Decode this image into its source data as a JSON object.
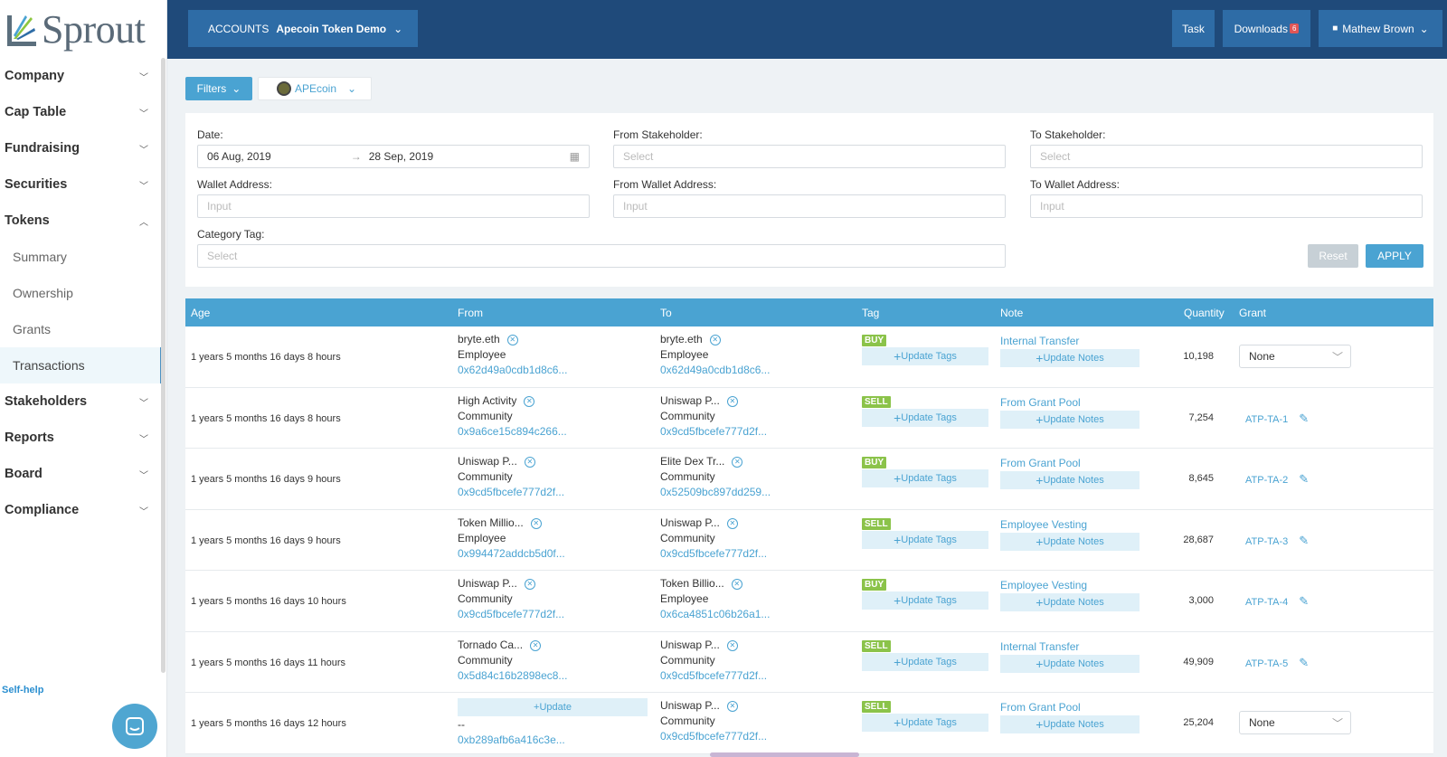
{
  "logo": {
    "text": "Sprout"
  },
  "sidebar": {
    "items": [
      {
        "label": "Company",
        "expanded": false
      },
      {
        "label": "Cap Table",
        "expanded": false
      },
      {
        "label": "Fundraising",
        "expanded": false
      },
      {
        "label": "Securities",
        "expanded": false
      },
      {
        "label": "Tokens",
        "expanded": true
      },
      {
        "label": "Stakeholders",
        "expanded": false
      },
      {
        "label": "Reports",
        "expanded": false
      },
      {
        "label": "Board",
        "expanded": false
      },
      {
        "label": "Compliance",
        "expanded": false
      }
    ],
    "token_subitems": [
      "Summary",
      "Ownership",
      "Grants",
      "Transactions"
    ],
    "active_subitem": "Transactions",
    "self_help": "Self-help"
  },
  "header": {
    "accounts_label": "ACCOUNTS",
    "account_name": "Apecoin Token Demo",
    "task": "Task",
    "downloads": "Downloads",
    "downloads_count": "6",
    "user": "Mathew Brown"
  },
  "filterbar": {
    "filters": "Filters",
    "token": "APEcoin"
  },
  "panel": {
    "date_label": "Date",
    "date_from": "06 Aug, 2019",
    "date_to": "28 Sep, 2019",
    "from_stakeholder_label": "From Stakeholder",
    "to_stakeholder_label": "To Stakeholder",
    "wallet_label": "Wallet Address",
    "from_wallet_label": "From Wallet Address",
    "to_wallet_label": "To Wallet Address",
    "category_label": "Category Tag",
    "select_ph": "Select",
    "input_ph": "Input",
    "reset": "Reset",
    "apply": "APPLY"
  },
  "table": {
    "columns": [
      "Age",
      "From",
      "To",
      "Tag",
      "Note",
      "Quantity",
      "Grant"
    ],
    "update_tags": "Update Tags",
    "update_notes": "Update Notes",
    "update": "Update",
    "rows": [
      {
        "age": "1 years 5 months 16 days 8 hours",
        "from_name": "bryte.eth",
        "from_role": "Employee",
        "from_addr": "0x62d49a0cdb1d8c6...",
        "to_name": "bryte.eth",
        "to_role": "Employee",
        "to_addr": "0x62d49a0cdb1d8c6...",
        "tag": "BUY",
        "note": "Internal Transfer",
        "qty": "10,198",
        "grant": "None",
        "grant_type": "select"
      },
      {
        "age": "1 years 5 months 16 days 8 hours",
        "from_name": "High Activity",
        "from_role": "Community",
        "from_addr": "0x9a6ce15c894c266...",
        "to_name": "Uniswap P...",
        "to_role": "Community",
        "to_addr": "0x9cd5fbcefe777d2f...",
        "tag": "SELL",
        "note": "From Grant Pool",
        "qty": "7,254",
        "grant": "ATP-TA-1",
        "grant_type": "link"
      },
      {
        "age": "1 years 5 months 16 days 9 hours",
        "from_name": "Uniswap P...",
        "from_role": "Community",
        "from_addr": "0x9cd5fbcefe777d2f...",
        "to_name": "Elite Dex Tr...",
        "to_role": "Community",
        "to_addr": "0x52509bc897dd259...",
        "tag": "BUY",
        "note": "From Grant Pool",
        "qty": "8,645",
        "grant": "ATP-TA-2",
        "grant_type": "link"
      },
      {
        "age": "1 years 5 months 16 days 9 hours",
        "from_name": "Token Millio...",
        "from_role": "Employee",
        "from_addr": "0x994472addcb5d0f...",
        "to_name": "Uniswap P...",
        "to_role": "Community",
        "to_addr": "0x9cd5fbcefe777d2f...",
        "tag": "SELL",
        "note": "Employee Vesting",
        "qty": "28,687",
        "grant": "ATP-TA-3",
        "grant_type": "link"
      },
      {
        "age": "1 years 5 months 16 days 10 hours",
        "from_name": "Uniswap P...",
        "from_role": "Community",
        "from_addr": "0x9cd5fbcefe777d2f...",
        "to_name": "Token Billio...",
        "to_role": "Employee",
        "to_addr": "0x6ca4851c06b26a1...",
        "tag": "BUY",
        "note": "Employee Vesting",
        "qty": "3,000",
        "grant": "ATP-TA-4",
        "grant_type": "link"
      },
      {
        "age": "1 years 5 months 16 days 11 hours",
        "from_name": "Tornado Ca...",
        "from_role": "Community",
        "from_addr": "0x5d84c16b2898ec8...",
        "to_name": "Uniswap P...",
        "to_role": "Community",
        "to_addr": "0x9cd5fbcefe777d2f...",
        "tag": "SELL",
        "note": "Internal Transfer",
        "qty": "49,909",
        "grant": "ATP-TA-5",
        "grant_type": "link"
      },
      {
        "age": "1 years 5 months 16 days 12 hours",
        "from_name": "",
        "from_role": "--",
        "from_addr": "0xb289afb6a416c3e...",
        "to_name": "Uniswap P...",
        "to_role": "Community",
        "to_addr": "0x9cd5fbcefe777d2f...",
        "tag": "SELL",
        "note": "From Grant Pool",
        "qty": "25,204",
        "grant": "None",
        "grant_type": "select",
        "from_update": true
      }
    ]
  }
}
